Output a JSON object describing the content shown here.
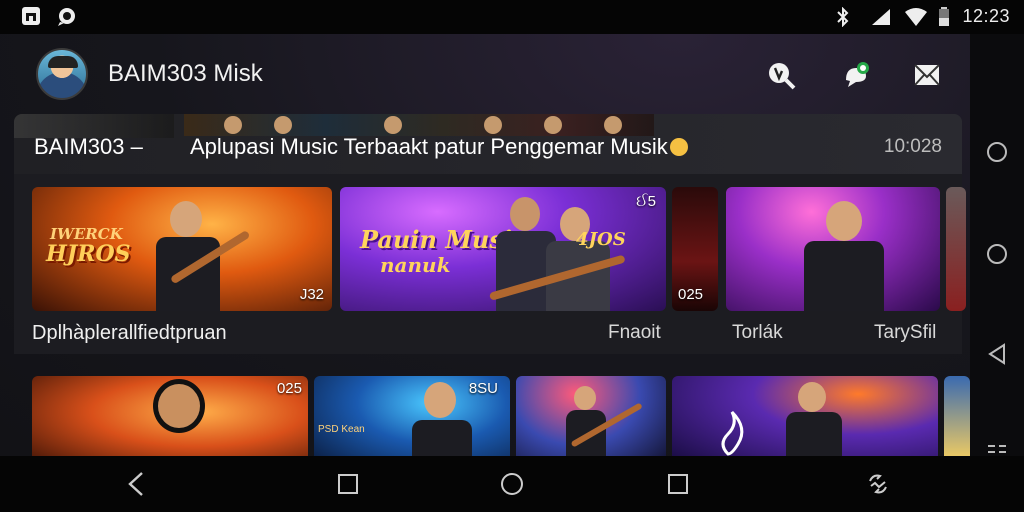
{
  "status_bar": {
    "time": "12:23",
    "left_icons": [
      "app-notification-icon",
      "chat-notification-icon"
    ],
    "right_icons": [
      "bluetooth-icon",
      "signal-icon",
      "wifi-icon",
      "battery-icon"
    ]
  },
  "app_bar": {
    "title": "BAIM303 Misk",
    "actions": [
      "search-icon",
      "chat-icon",
      "mail-icon",
      "more-vert-icon"
    ]
  },
  "banner": {
    "brand": "BAIM303 –",
    "text": "Aplupasi Music Terbaakt patur Penggemar Musik",
    "time": "10:028"
  },
  "row1": {
    "cards": [
      {
        "title": "HJROS",
        "subtitle": "IWERCK",
        "badge": "J32"
      },
      {
        "title": "Pauin Music",
        "subtitle": "nanuk",
        "badge_top": "ઈ5",
        "right_text": "4JOS"
      },
      {
        "badge": "025"
      },
      {}
    ],
    "labels": [
      "Dplhàplerallfiedtpruan",
      "Fnaoit",
      "Torlák",
      "TarySfil"
    ]
  },
  "row2": {
    "cards": [
      {
        "badge": "025"
      },
      {
        "badge": "8SU",
        "text": "PSD Kean"
      },
      {},
      {}
    ]
  },
  "side_nav": [
    "circle-icon",
    "circle-icon",
    "back-triangle-icon",
    "menu-icon"
  ],
  "bottom_nav": [
    "back-chevron-icon",
    "square-icon",
    "home-circle-icon",
    "square-icon",
    "rotate-icon"
  ],
  "colors": {
    "background": "#16161c",
    "accent_purple": "#7b2fd6",
    "accent_orange": "#e8701a"
  }
}
